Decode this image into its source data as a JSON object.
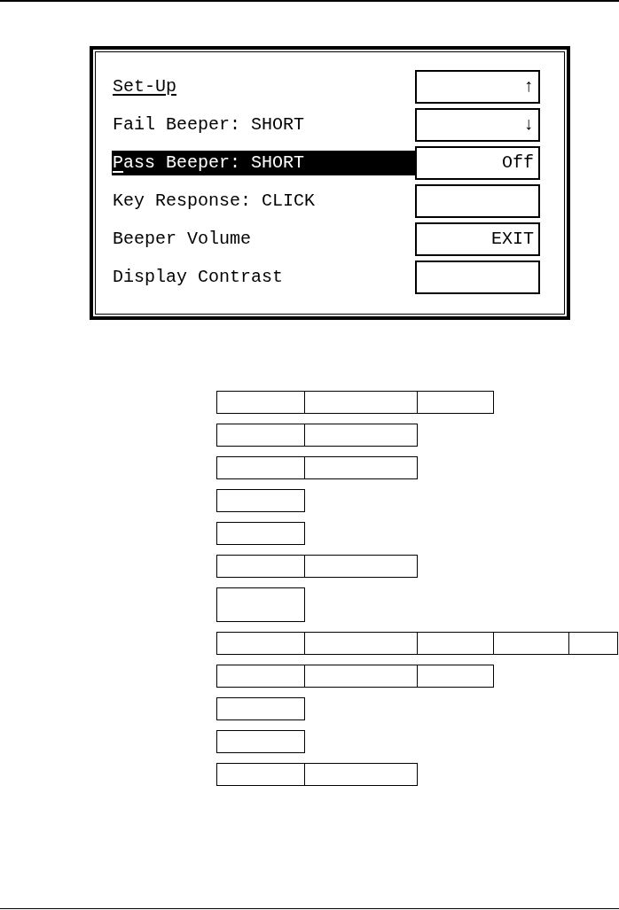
{
  "display": {
    "title": "Set-Up",
    "menu_items": [
      {
        "label": "Fail Beeper: SHORT",
        "selected": false
      },
      {
        "label": "Pass Beeper: SHORT",
        "selected": true
      },
      {
        "label": "Key Response: CLICK",
        "selected": false
      },
      {
        "label": "Beeper Volume",
        "selected": false
      },
      {
        "label": "Display Contrast",
        "selected": false
      }
    ],
    "soft_keys": [
      {
        "kind": "label",
        "label": "↑"
      },
      {
        "kind": "label",
        "label": "↓"
      },
      {
        "kind": "label",
        "label": "Off"
      },
      {
        "kind": "blank"
      },
      {
        "kind": "label",
        "label": "EXIT"
      },
      {
        "kind": "blank"
      }
    ]
  },
  "box_rows": [
    {
      "cells": [
        {
          "kind": "box"
        },
        {
          "kind": "box"
        },
        {
          "kind": "box"
        }
      ]
    },
    {
      "cells": [
        {
          "kind": "box"
        },
        {
          "kind": "box"
        }
      ]
    },
    {
      "cells": [
        {
          "kind": "box"
        },
        {
          "kind": "box"
        }
      ]
    },
    {
      "cells": [
        {
          "kind": "box"
        }
      ]
    },
    {
      "cells": [
        {
          "kind": "box"
        }
      ]
    },
    {
      "cells": [
        {
          "kind": "box"
        },
        {
          "kind": "box"
        }
      ]
    },
    {
      "cells": [
        {
          "kind": "tall"
        }
      ]
    },
    {
      "cells": [
        {
          "kind": "box"
        },
        {
          "kind": "box"
        },
        {
          "kind": "box"
        },
        {
          "kind": "box"
        },
        {
          "kind": "box"
        }
      ]
    },
    {
      "cells": [
        {
          "kind": "box"
        },
        {
          "kind": "box"
        },
        {
          "kind": "box"
        }
      ]
    },
    {
      "cells": [
        {
          "kind": "box"
        }
      ]
    },
    {
      "cells": [
        {
          "kind": "box"
        }
      ]
    },
    {
      "cells": [
        {
          "kind": "box"
        },
        {
          "kind": "box"
        }
      ]
    }
  ]
}
